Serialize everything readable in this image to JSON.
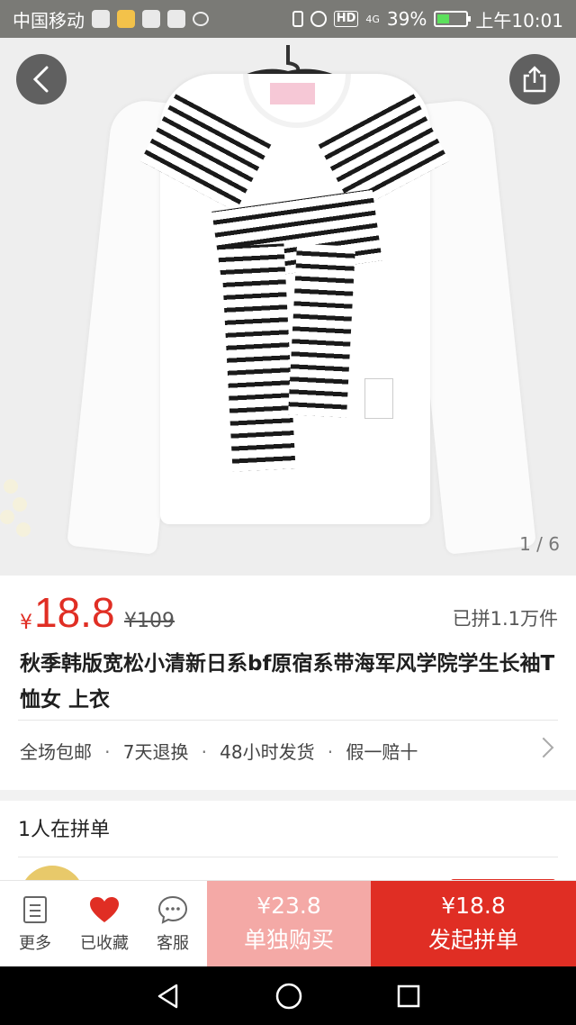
{
  "status_bar": {
    "carrier": "中国移动",
    "battery": "39%",
    "time": "上午10:01",
    "network": "4G",
    "hd": "HD"
  },
  "gallery": {
    "page_indicator": "1 / 6"
  },
  "product": {
    "currency": "¥",
    "price": "18.8",
    "original_price": "¥109",
    "sold_count": "已拼1.1万件",
    "title": "秋季韩版宽松小清新日系bf原宿系带海军风学院学生长袖T恤女 上衣",
    "promises": [
      "全场包邮",
      "7天退换",
      "48小时发货",
      "假一赔十"
    ],
    "promise_separator": "·"
  },
  "group": {
    "title": "1人在拼单"
  },
  "action_bar": {
    "more_label": "更多",
    "favorite_label": "已收藏",
    "service_label": "客服",
    "buy_alone_price": "¥23.8",
    "buy_alone_label": "单独购买",
    "buy_group_price": "¥18.8",
    "buy_group_label": "发起拼单"
  },
  "colors": {
    "accent": "#e02e24",
    "accent_light": "#f4a9a6"
  }
}
